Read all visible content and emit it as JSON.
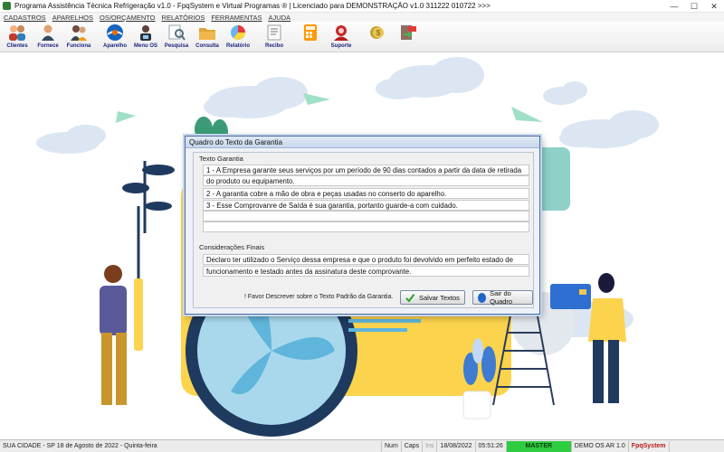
{
  "window": {
    "title": "Programa Assistência Técnica Refrigeração v1.0 - FpqSystem e Virtual Programas ® | Licenciado para DEMONSTRAÇÃO v1.0 311222 010722 >>>",
    "controls": [
      "—",
      "☐",
      "✕"
    ]
  },
  "menu": {
    "items": [
      "CADASTROS",
      "APARELHOS",
      "OS/ORÇAMENTO",
      "RELATÓRIOS",
      "FERRAMENTAS",
      "AJUDA"
    ]
  },
  "toolbar": {
    "buttons": [
      {
        "label": "Clientes",
        "icon": "clients-icon"
      },
      {
        "label": "Fornece",
        "icon": "suppliers-icon"
      },
      {
        "label": "Funciona",
        "icon": "employees-icon"
      },
      {
        "label": "Aparelho",
        "icon": "ac-unit-icon"
      },
      {
        "label": "Menu OS",
        "icon": "technician-icon"
      },
      {
        "label": "Pesquisa",
        "icon": "search-icon"
      },
      {
        "label": "Consulta",
        "icon": "folder-icon"
      },
      {
        "label": "Relatório",
        "icon": "report-icon"
      },
      {
        "label": "Recibo",
        "icon": "receipt-icon"
      },
      {
        "label": "",
        "icon": "calculator-icon"
      },
      {
        "label": "Suporte",
        "icon": "support-icon"
      },
      {
        "label": "",
        "icon": "coins-icon"
      },
      {
        "label": "",
        "icon": "exit-icon"
      }
    ]
  },
  "dialog": {
    "title": "Quadro do Texto da Garantia",
    "warranty_label": "Texto Garantia",
    "warranty_lines": [
      "1 - A Empresa garante seus serviços por um período de 90 dias contados a partir da data de retirada",
      "do produto ou equipamento.",
      "2 - A garantia cobre a mão de obra e peças usadas no conserto do aparelho.",
      "3 - Esse Comprovanre de Saída é sua garantia, portanto guarde-a com cuidado.",
      "",
      ""
    ],
    "final_label": "Considerações Finais",
    "final_lines": [
      "Declaro ter utilizado o Serviço dessa empresa e que o produto foi devolvido em perfeito estado de",
      "funcionamento e testado antes da assinatura deste comprovante."
    ],
    "note": "! Favor Descrever sobre o Texto Padrão da Garantia.",
    "save_label": "Salvar Textos",
    "exit_label": "Sair do Quadro"
  },
  "status": {
    "city": "SUA CIDADE - SP 18 de Agosto de 2022 - Quinta-feira",
    "num": "Num",
    "caps": "Caps",
    "ins": "Ins",
    "date": "18/08/2022",
    "time": "05:51:26",
    "mode": "MASTER",
    "edition": "DEMO OS AR 1.0",
    "brand": "FpqSystem"
  },
  "colors": {
    "accent": "#2e7d32",
    "illustration_yellow": "#fcd34d",
    "illustration_blue": "#1f3a5f",
    "cloud": "#d8e4f0",
    "status_green": "#2ecc40"
  }
}
